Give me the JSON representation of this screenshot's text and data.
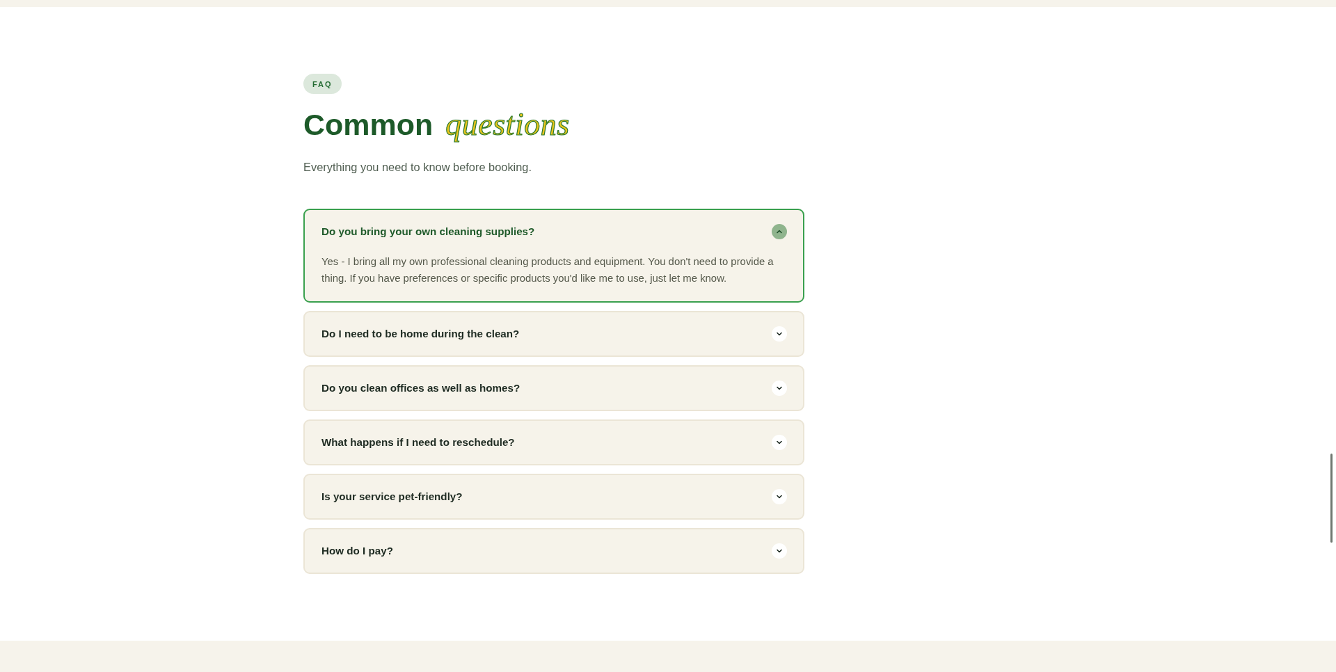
{
  "section_badge": "FAQ",
  "heading": "Common *questions*",
  "subtitle": "Everything you need to know before booking.",
  "faq_items": [
    {
      "question": "Do you bring your own cleaning supplies?",
      "expanded": true,
      "answer": "Yes - I bring all my own professional cleaning products and equipment. You don't need to provide a thing. If you have preferences or specific products you'd like me to use, just let me know."
    },
    {
      "question": "Do I need to be home during the clean?",
      "expanded": false
    },
    {
      "question": "Do you clean offices as well as homes?",
      "expanded": false
    },
    {
      "question": "What happens if I need to reschedule?",
      "expanded": false
    },
    {
      "question": "Is your service pet-friendly?",
      "expanded": false
    },
    {
      "question": "How do I pay?",
      "expanded": false
    }
  ]
}
